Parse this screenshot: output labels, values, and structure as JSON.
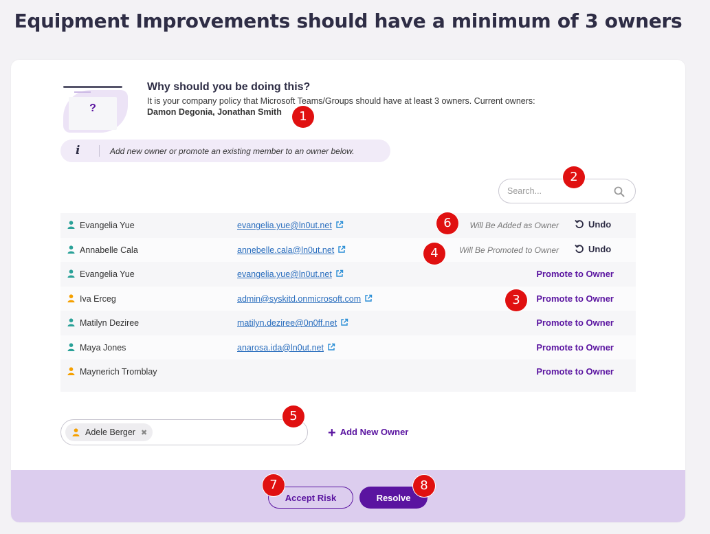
{
  "page": {
    "title": "Equipment Improvements should have a minimum of 3 owners"
  },
  "explanation": {
    "heading": "Why should you be doing this?",
    "text": "It is your company policy that Microsoft Teams/Groups should have at least 3 owners. Current owners:",
    "current_owners": "Damon Degonia, Jonathan Smith",
    "illustration_glyph": "?"
  },
  "info_bar": {
    "icon": "i",
    "text": "Add new owner or promote an existing member to an owner below."
  },
  "search": {
    "placeholder": "Search..."
  },
  "members": [
    {
      "name": "Evangelia Yue",
      "email": "evangelia.yue@ln0ut.net",
      "status": "Will Be Added as Owner",
      "action": "Undo",
      "user_color": "#2aa198"
    },
    {
      "name": "Annabelle Cala",
      "email": "annebelle.cala@ln0ut.net",
      "status": "Will Be Promoted to Owner",
      "action": "Undo",
      "user_color": "#2aa198"
    },
    {
      "name": "Evangelia Yue",
      "email": "evangelia.yue@ln0ut.net",
      "status": "",
      "action": "Promote to Owner",
      "user_color": "#2aa198"
    },
    {
      "name": "Iva Erceg",
      "email": "admin@syskitd.onmicrosoft.com",
      "status": "",
      "action": "Promote to Owner",
      "user_color": "#f5a000"
    },
    {
      "name": "Matilyn Deziree",
      "email": "matilyn.deziree@0n0ff.net",
      "status": "",
      "action": "Promote to Owner",
      "user_color": "#2aa198"
    },
    {
      "name": "Maya Jones",
      "email": "anarosa.ida@ln0ut.net",
      "status": "",
      "action": "Promote to Owner",
      "user_color": "#2aa198"
    },
    {
      "name": "Maynerich Tromblay",
      "email": "",
      "status": "",
      "action": "Promote to Owner",
      "user_color": "#f5a000"
    }
  ],
  "new_owner": {
    "chip_name": "Adele Berger",
    "chip_remove": "✖",
    "add_label": "Add New Owner",
    "add_icon": "+"
  },
  "footer": {
    "accept_label": "Accept Risk",
    "resolve_label": "Resolve"
  },
  "callouts": [
    "1",
    "2",
    "3",
    "4",
    "5",
    "6",
    "7",
    "8"
  ],
  "colors": {
    "accent": "#5a14a0",
    "footer_bg": "#dccdee",
    "callout": "#e01010",
    "link": "#2a6ebe"
  }
}
